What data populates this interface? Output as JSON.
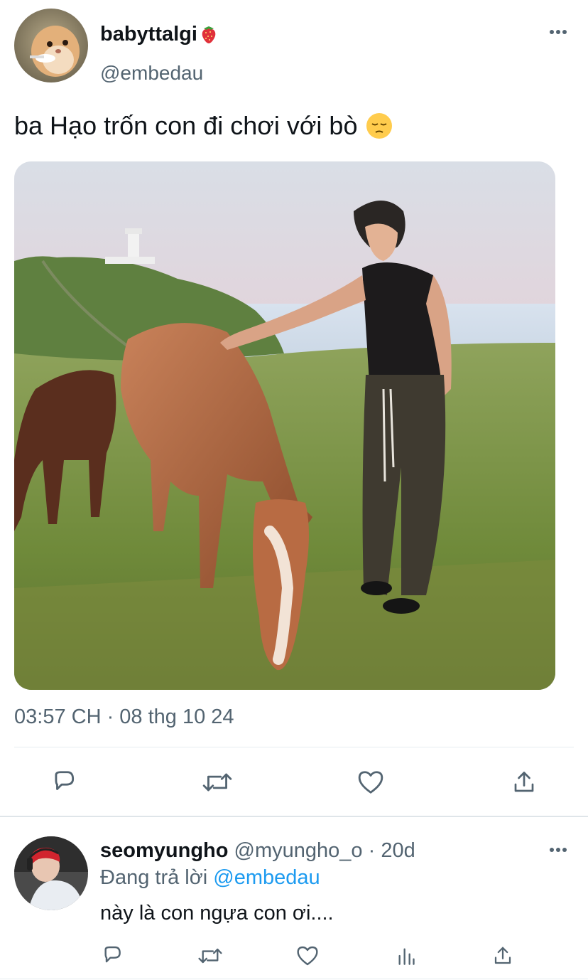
{
  "tweet": {
    "display_name": "babyttalgi",
    "name_emoji": "strawberry-icon",
    "handle": "@embedau",
    "text": "ba Hạo trốn con đi chơi với bò",
    "text_emoji": "pensive-face-icon",
    "timestamp": "03:57 CH · 08 thg 10 24",
    "media_alt": "photo-person-with-horses"
  },
  "actions": [
    "reply-icon",
    "retweet-icon",
    "like-icon",
    "share-icon"
  ],
  "reply": {
    "display_name": "seomyungho",
    "handle": "@myungho_o",
    "separator": " · ",
    "time": "20d",
    "replying_to_prefix": "Đang trả lời",
    "replying_to_handle": "@embedau",
    "text": "này là con ngựa con ơi....",
    "actions": [
      "reply-icon",
      "retweet-icon",
      "like-icon",
      "analytics-icon",
      "share-icon"
    ]
  },
  "colors": {
    "text": "#0f1419",
    "muted": "#536471",
    "link": "#1d9bf0",
    "divider": "#e6ecf0"
  }
}
